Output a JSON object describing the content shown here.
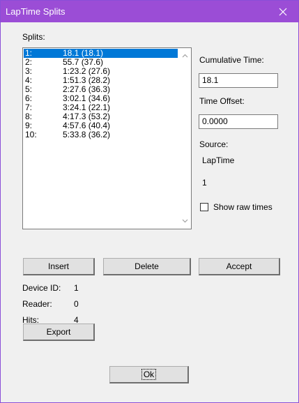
{
  "window": {
    "title": "LapTime Splits"
  },
  "labels": {
    "splits": "Splits:",
    "cumulative_time": "Cumulative Time:",
    "time_offset": "Time Offset:",
    "source": "Source:",
    "source_value": "LapTime",
    "source_number": "1",
    "show_raw_times": "Show raw times",
    "device_id": "Device ID:",
    "device_id_value": "1",
    "reader": "Reader:",
    "reader_value": "0",
    "hits": "Hits:",
    "hits_value": "4"
  },
  "inputs": {
    "cumulative_time": "18.1",
    "time_offset": "0.0000"
  },
  "splits": [
    {
      "num": "1:",
      "value": "18.1 (18.1)"
    },
    {
      "num": "2:",
      "value": "55.7 (37.6)"
    },
    {
      "num": "3:",
      "value": "1:23.2 (27.6)"
    },
    {
      "num": "4:",
      "value": "1:51.3 (28.2)"
    },
    {
      "num": "5:",
      "value": "2:27.6 (36.3)"
    },
    {
      "num": "6:",
      "value": "3:02.1 (34.6)"
    },
    {
      "num": "7:",
      "value": "3:24.1 (22.1)"
    },
    {
      "num": "8:",
      "value": "4:17.3 (53.2)"
    },
    {
      "num": "9:",
      "value": "4:57.6 (40.4)"
    },
    {
      "num": "10:",
      "value": "5:33.8 (36.2)"
    }
  ],
  "buttons": {
    "insert": "Insert",
    "delete": "Delete",
    "accept": "Accept",
    "export": "Export",
    "ok": "Ok"
  }
}
